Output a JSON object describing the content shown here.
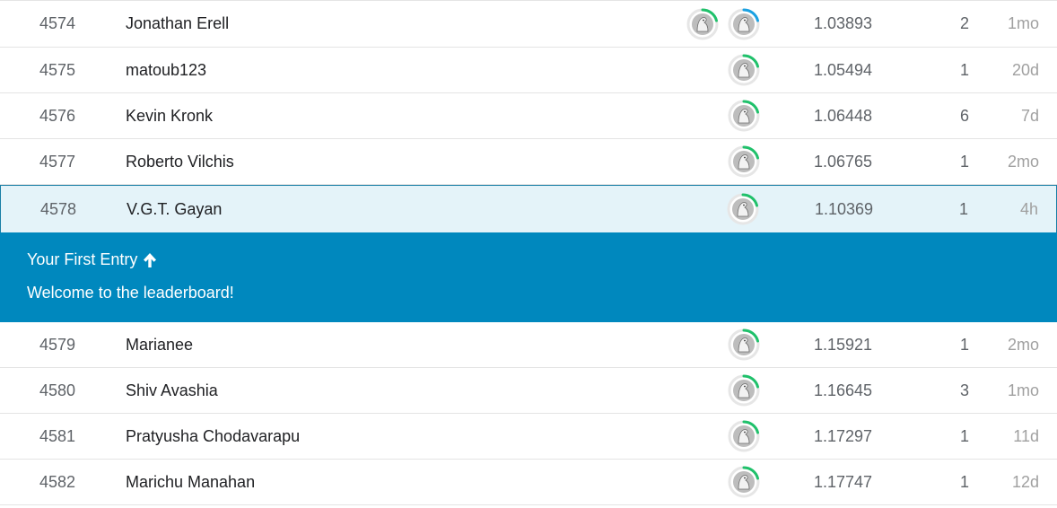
{
  "rows_before": [
    {
      "rank": "4574",
      "name": "Jonathan Erell",
      "avatars": [
        {
          "ring": "#20c16b"
        },
        {
          "ring": "#1ba1e2"
        }
      ],
      "score": "1.03893",
      "entries": "2",
      "last": "1mo"
    },
    {
      "rank": "4575",
      "name": "matoub123",
      "avatars": [
        {
          "ring": "#20c16b"
        }
      ],
      "score": "1.05494",
      "entries": "1",
      "last": "20d"
    },
    {
      "rank": "4576",
      "name": "Kevin Kronk",
      "avatars": [
        {
          "ring": "#20c16b"
        }
      ],
      "score": "1.06448",
      "entries": "6",
      "last": "7d"
    },
    {
      "rank": "4577",
      "name": "Roberto Vilchis",
      "avatars": [
        {
          "ring": "#20c16b"
        }
      ],
      "score": "1.06765",
      "entries": "1",
      "last": "2mo"
    }
  ],
  "highlight_row": {
    "rank": "4578",
    "name": "V.G.T. Gayan",
    "avatars": [
      {
        "ring": "#20c16b"
      }
    ],
    "score": "1.10369",
    "entries": "1",
    "last": "4h"
  },
  "banner": {
    "title": "Your First Entry",
    "title_icon": "arrow-up-icon",
    "message": "Welcome to the leaderboard!",
    "background": "#0088be"
  },
  "rows_after": [
    {
      "rank": "4579",
      "name": "Marianee",
      "avatars": [
        {
          "ring": "#20c16b"
        }
      ],
      "score": "1.15921",
      "entries": "1",
      "last": "2mo"
    },
    {
      "rank": "4580",
      "name": "Shiv Avashia",
      "avatars": [
        {
          "ring": "#20c16b"
        }
      ],
      "score": "1.16645",
      "entries": "3",
      "last": "1mo"
    },
    {
      "rank": "4581",
      "name": "Pratyusha Chodavarapu",
      "avatars": [
        {
          "ring": "#20c16b"
        }
      ],
      "score": "1.17297",
      "entries": "1",
      "last": "11d"
    },
    {
      "rank": "4582",
      "name": "Marichu Manahan",
      "avatars": [
        {
          "ring": "#20c16b"
        }
      ],
      "score": "1.17747",
      "entries": "1",
      "last": "12d"
    }
  ],
  "colors": {
    "highlight_bg": "#e4f3f9",
    "highlight_border": "#1a7fa6"
  }
}
